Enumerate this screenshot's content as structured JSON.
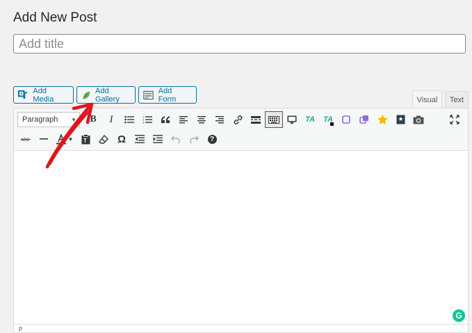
{
  "page": {
    "title": "Add New Post"
  },
  "title_input": {
    "placeholder": "Add title",
    "value": ""
  },
  "media_buttons": [
    {
      "label": "Add Media",
      "icon": "media-icon"
    },
    {
      "label": "Add Gallery",
      "icon": "leaf-icon"
    },
    {
      "label": "Add Form",
      "icon": "form-icon"
    }
  ],
  "editor_tabs": {
    "visual": "Visual",
    "text": "Text",
    "active": "visual"
  },
  "toolbar": {
    "format_select": "Paragraph",
    "row1": [
      "bold-icon",
      "italic-icon",
      "bullet-list-icon",
      "numbered-list-icon",
      "blockquote-icon",
      "align-left-icon",
      "align-center-icon",
      "align-right-icon",
      "link-icon",
      "read-more-icon",
      "toolbar-toggle-icon",
      "screen-icon",
      "ta-icon",
      "ta-plus-icon",
      "square-icon",
      "duplicate-icon",
      "star-icon",
      "bookmark-icon",
      "camera-icon"
    ],
    "row2": [
      "strikethrough-icon",
      "horizontal-line-icon",
      "text-color-icon",
      "paste-text-icon",
      "clear-formatting-icon",
      "special-character-icon",
      "outdent-icon",
      "indent-icon",
      "undo-icon",
      "redo-icon",
      "help-icon"
    ],
    "bold": "B",
    "italic": "I",
    "omega": "Ω",
    "help": "?",
    "ta": "TA"
  },
  "status_bar": {
    "path": "p"
  },
  "grammarly": {
    "label": "G"
  },
  "colors": {
    "accent": "#0071a1",
    "annotation_arrow": "#e0161c",
    "leaf": "#6ab04c",
    "star": "#f6b900",
    "ta": "#2ea58f",
    "purple": "#8e6bdb",
    "grammarly": "#15c39a"
  }
}
